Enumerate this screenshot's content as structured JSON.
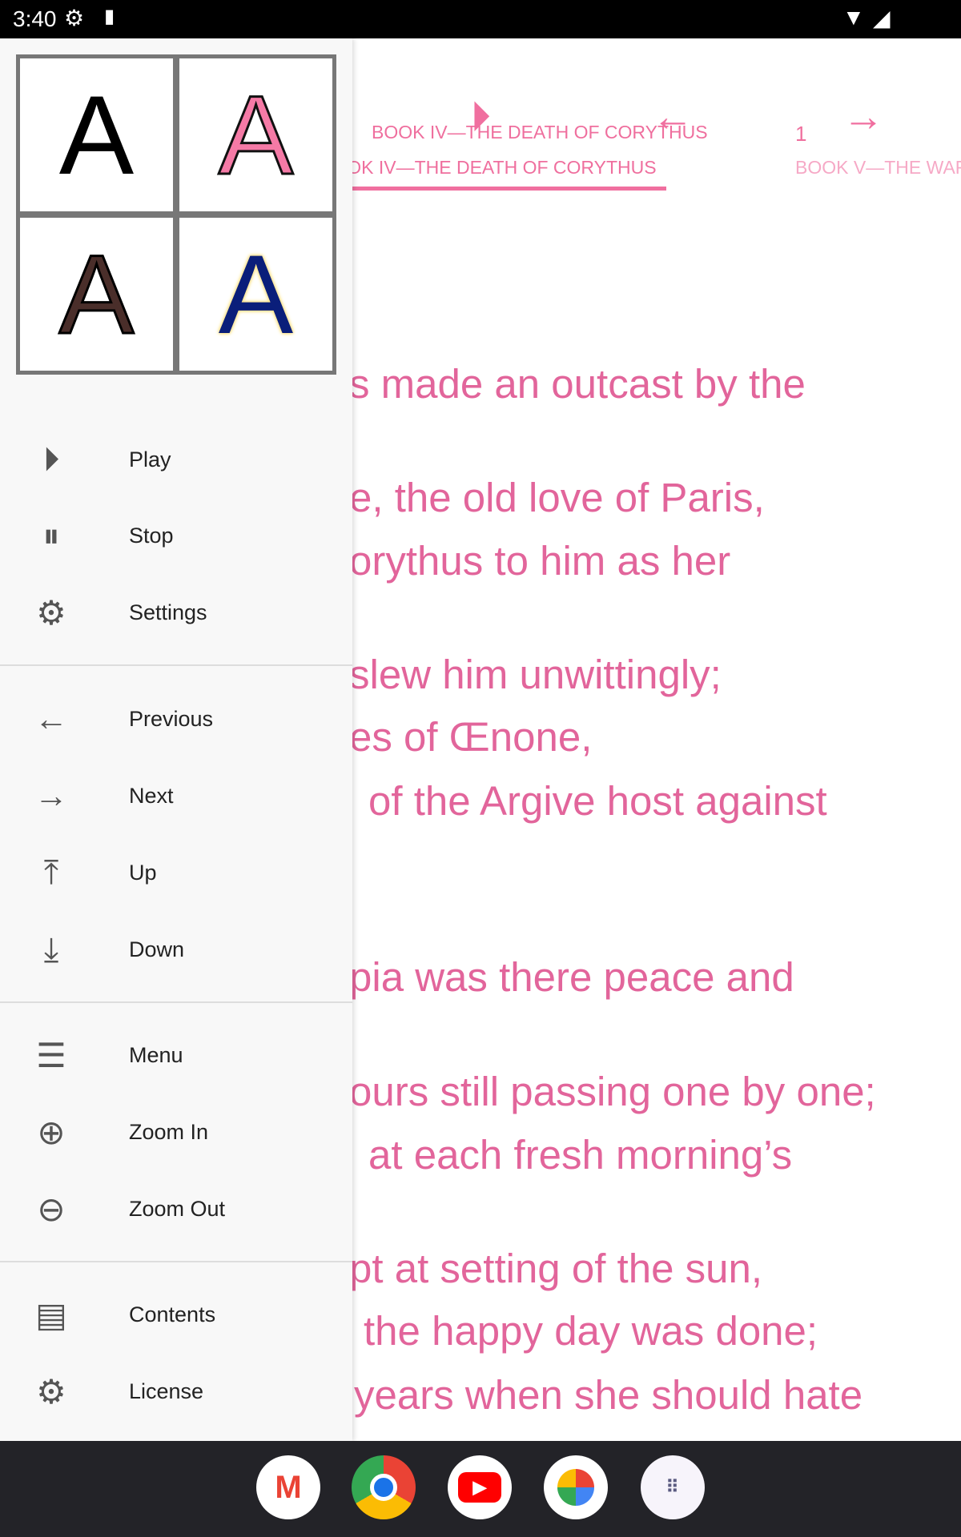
{
  "status": {
    "time": "3:40"
  },
  "reader": {
    "toolbar": {
      "play": "play-icon",
      "prev": "arrow-left-icon",
      "next": "arrow-right-icon"
    },
    "chapter_title": "BOOK IV—THE DEATH OF CORYTHUS",
    "page_number": "1",
    "tabs": [
      {
        "label": "BOOK IV—THE DEATH OF CORYTHUS"
      },
      {
        "label": "BOOK V—THE WAR"
      }
    ],
    "accent": "#f06f9f",
    "lines": [
      "s made an outcast by the",
      "e, the old love of Paris,",
      "orythus to him as her",
      "slew him unwittingly;",
      "es of Œnone,",
      "of the Argive host against",
      "pia was there peace and",
      "ours still passing one by one;",
      "at each fresh morning’s",
      "pt at setting of the sun,",
      "the happy day was done;",
      "years when she should hate"
    ]
  },
  "drawer": {
    "font_styles": [
      {
        "letter": "A",
        "style": "black"
      },
      {
        "letter": "A",
        "style": "pink-outlined"
      },
      {
        "letter": "A",
        "style": "brown-outlined"
      },
      {
        "letter": "A",
        "style": "navy-yellow-outline"
      }
    ],
    "items": [
      {
        "label": "Play",
        "icon": "play-circle-icon"
      },
      {
        "label": "Stop",
        "icon": "pause-circle-icon"
      },
      {
        "label": "Settings",
        "icon": "gear-icon"
      },
      {
        "label": "Previous",
        "icon": "arrow-left-icon"
      },
      {
        "label": "Next",
        "icon": "arrow-right-icon"
      },
      {
        "label": "Up",
        "icon": "arrow-up-to-top-icon"
      },
      {
        "label": "Down",
        "icon": "arrow-down-to-bottom-icon"
      },
      {
        "label": "Menu",
        "icon": "hamburger-icon"
      },
      {
        "label": "Zoom In",
        "icon": "zoom-in-icon"
      },
      {
        "label": "Zoom Out",
        "icon": "zoom-out-icon"
      },
      {
        "label": "Contents",
        "icon": "document-icon"
      },
      {
        "label": "License",
        "icon": "gear-box-icon"
      }
    ]
  },
  "dock": {
    "apps": [
      "gmail",
      "chrome",
      "youtube",
      "photos",
      "app-drawer"
    ]
  }
}
